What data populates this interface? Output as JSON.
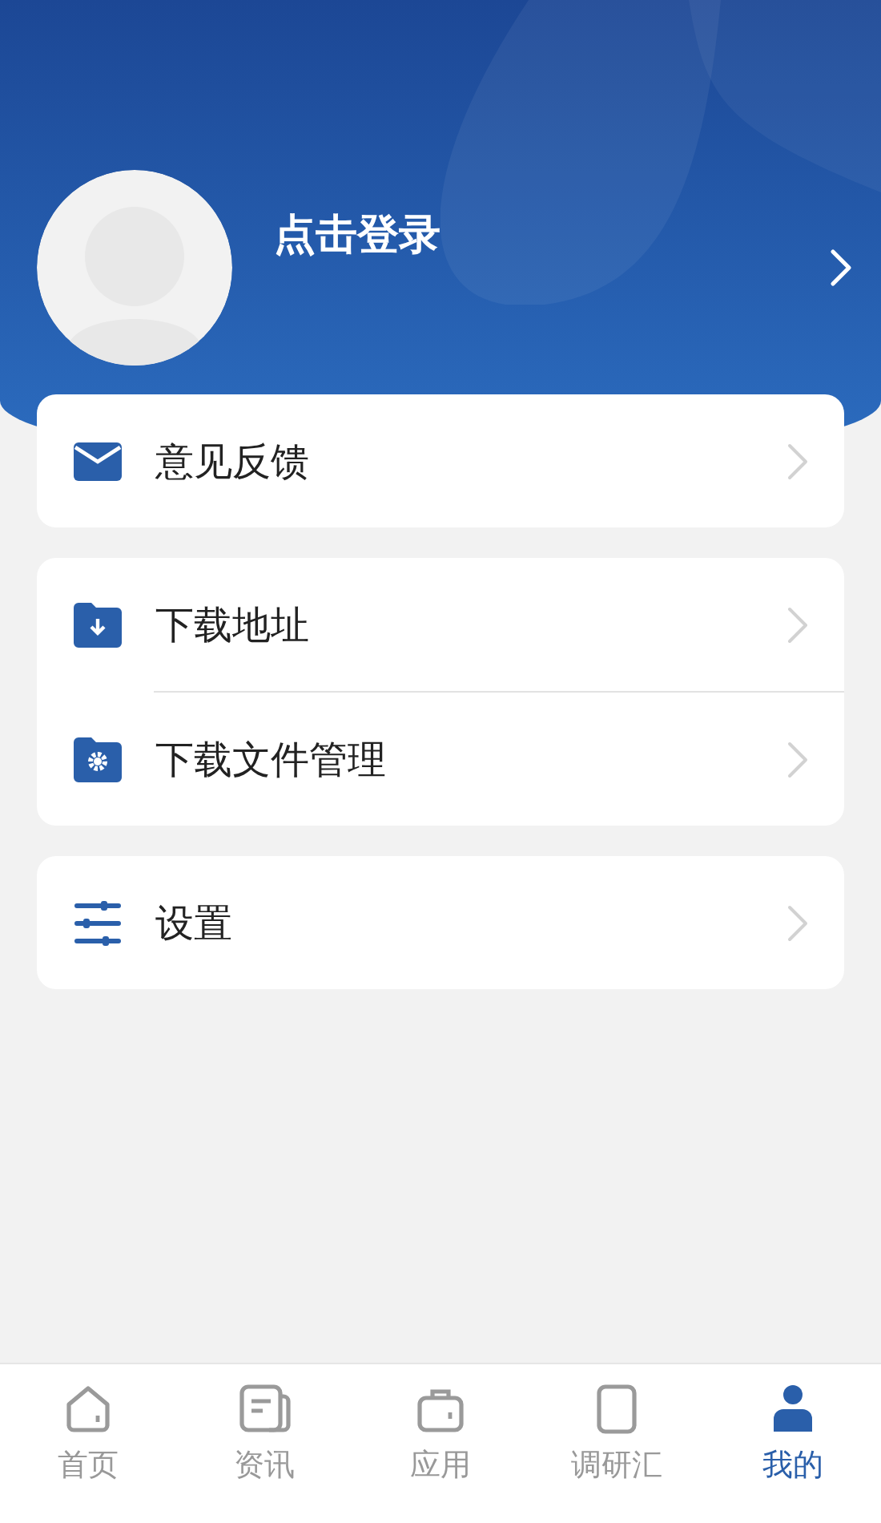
{
  "profile": {
    "login_label": "点击登录"
  },
  "menu_groups": [
    {
      "items": [
        {
          "kind": "mail",
          "label": "意见反馈"
        }
      ]
    },
    {
      "items": [
        {
          "kind": "download-folder",
          "label": "下载地址"
        },
        {
          "kind": "settings-folder",
          "label": "下载文件管理"
        }
      ]
    },
    {
      "items": [
        {
          "kind": "sliders",
          "label": "设置"
        }
      ]
    }
  ],
  "tab_bar": [
    {
      "kind": "home",
      "label": "首页",
      "selected": false
    },
    {
      "kind": "news",
      "label": "资讯",
      "selected": false
    },
    {
      "kind": "briefcase",
      "label": "应用",
      "selected": false
    },
    {
      "kind": "device",
      "label": "调研汇",
      "selected": false
    },
    {
      "kind": "person",
      "label": "我的",
      "selected": true
    }
  ]
}
